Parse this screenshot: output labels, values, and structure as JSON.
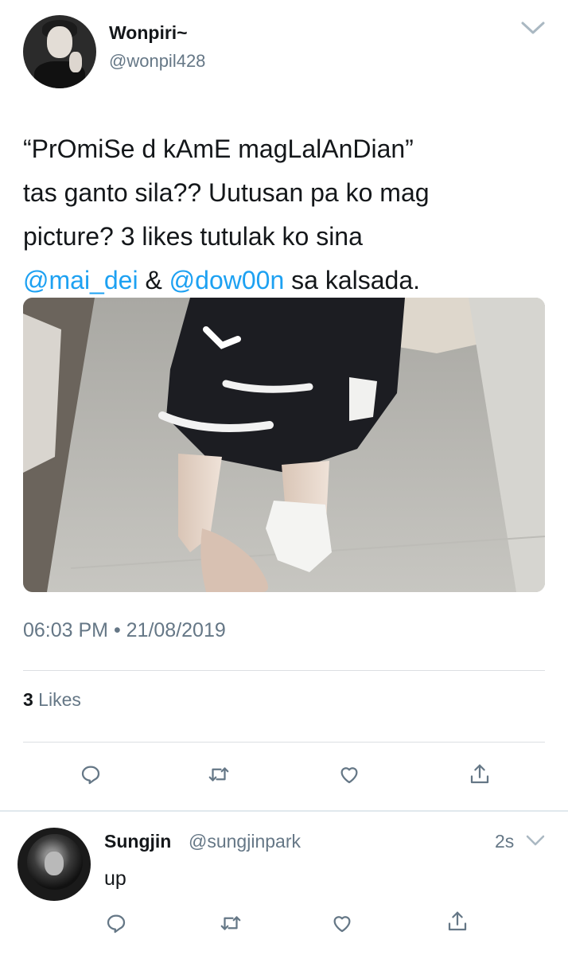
{
  "tweet": {
    "display_name": "Wonpiri~",
    "handle": "@wonpil428",
    "text_lines": {
      "l1": "“PrOmiSe d kAmE magLalAnDian”",
      "l2": "tas ganto sila?? Uutusan pa ko mag",
      "l3": "picture? 3 likes tutulak ko sina",
      "mention1": "@mai_dei",
      "amp": " & ",
      "mention2": "@dow00n",
      "l4_end": " sa kalsada."
    },
    "timestamp": "06:03 PM • 21/08/2019",
    "likes_count": "3",
    "likes_label": " Likes",
    "actions": [
      "reply-icon",
      "retweet-icon",
      "like-icon",
      "share-icon"
    ]
  },
  "reply": {
    "display_name": "Sungjin",
    "handle": "@sungjinpark",
    "time": "2s",
    "text": "up",
    "actions": [
      "reply-icon",
      "retweet-icon",
      "like-icon",
      "share-icon"
    ]
  },
  "colors": {
    "link": "#1da1f2",
    "secondary_text": "#657786",
    "primary_text": "#14171a",
    "divider": "#dcdfe2"
  }
}
